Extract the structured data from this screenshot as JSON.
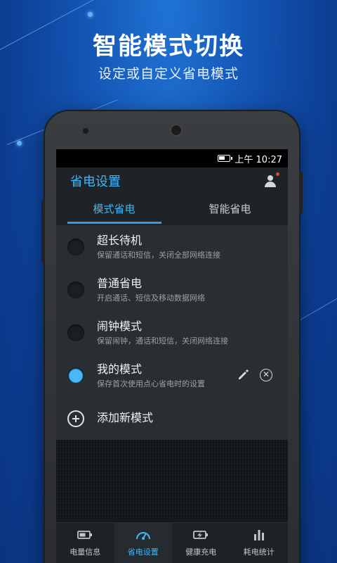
{
  "promo": {
    "headline": "智能模式切换",
    "subline": "设定或自定义省电模式"
  },
  "status_bar": {
    "time": "上午 10:27"
  },
  "app_bar": {
    "title": "省电设置"
  },
  "tabs": [
    {
      "label": "模式省电",
      "active": true
    },
    {
      "label": "智能省电",
      "active": false
    }
  ],
  "modes": [
    {
      "title": "超长待机",
      "subtitle": "保留通话和短信，关闭全部网络连接",
      "selected": false
    },
    {
      "title": "普通省电",
      "subtitle": "开启通话、短信及移动数据网络",
      "selected": false
    },
    {
      "title": "闹钟模式",
      "subtitle": "保留闹钟，通话和短信，关闭网络连接",
      "selected": false
    },
    {
      "title": "我的模式",
      "subtitle": "保存首次使用点心省电时的设置",
      "selected": true
    }
  ],
  "add_mode_label": "添加新模式",
  "bottom_nav": [
    {
      "label": "电量信息",
      "icon": "battery-icon",
      "active": false
    },
    {
      "label": "省电设置",
      "icon": "gauge-icon",
      "active": true
    },
    {
      "label": "健康充电",
      "icon": "charging-icon",
      "active": false
    },
    {
      "label": "耗电统计",
      "icon": "bar-chart-icon",
      "active": false
    }
  ],
  "colors": {
    "accent": "#40b6f5",
    "background_top": "#1f73d4",
    "background_bottom": "#0a3480"
  }
}
